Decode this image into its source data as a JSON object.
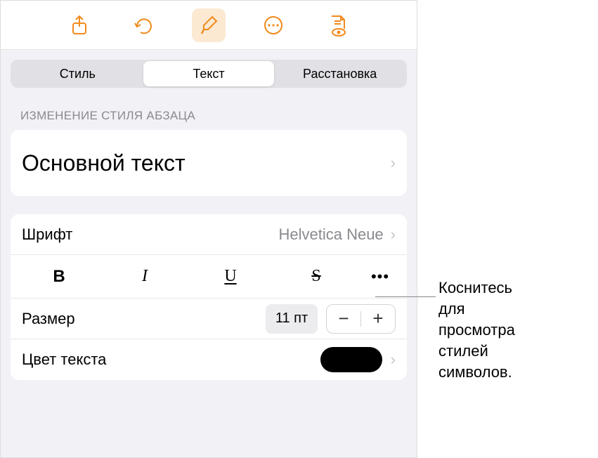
{
  "toolbar": {
    "share_icon": "share-icon",
    "undo_icon": "undo-icon",
    "format_icon": "format-brush-icon",
    "more_icon": "more-circle-icon",
    "doc_icon": "document-view-icon"
  },
  "segments": {
    "style": "Стиль",
    "text": "Текст",
    "layout": "Расстановка"
  },
  "section_header": "ИЗМЕНЕНИЕ СТИЛЯ АБЗАЦА",
  "paragraph_style": "Основной текст",
  "font": {
    "label": "Шрифт",
    "value": "Helvetica Neue"
  },
  "bius": {
    "bold": "B",
    "italic": "I",
    "underline": "U",
    "strike": "S",
    "more": "•••"
  },
  "size": {
    "label": "Размер",
    "value": "11 пт"
  },
  "text_color": {
    "label": "Цвет текста",
    "value_hex": "#000000"
  },
  "callout": "Коснитесь для просмотра стилей символов."
}
